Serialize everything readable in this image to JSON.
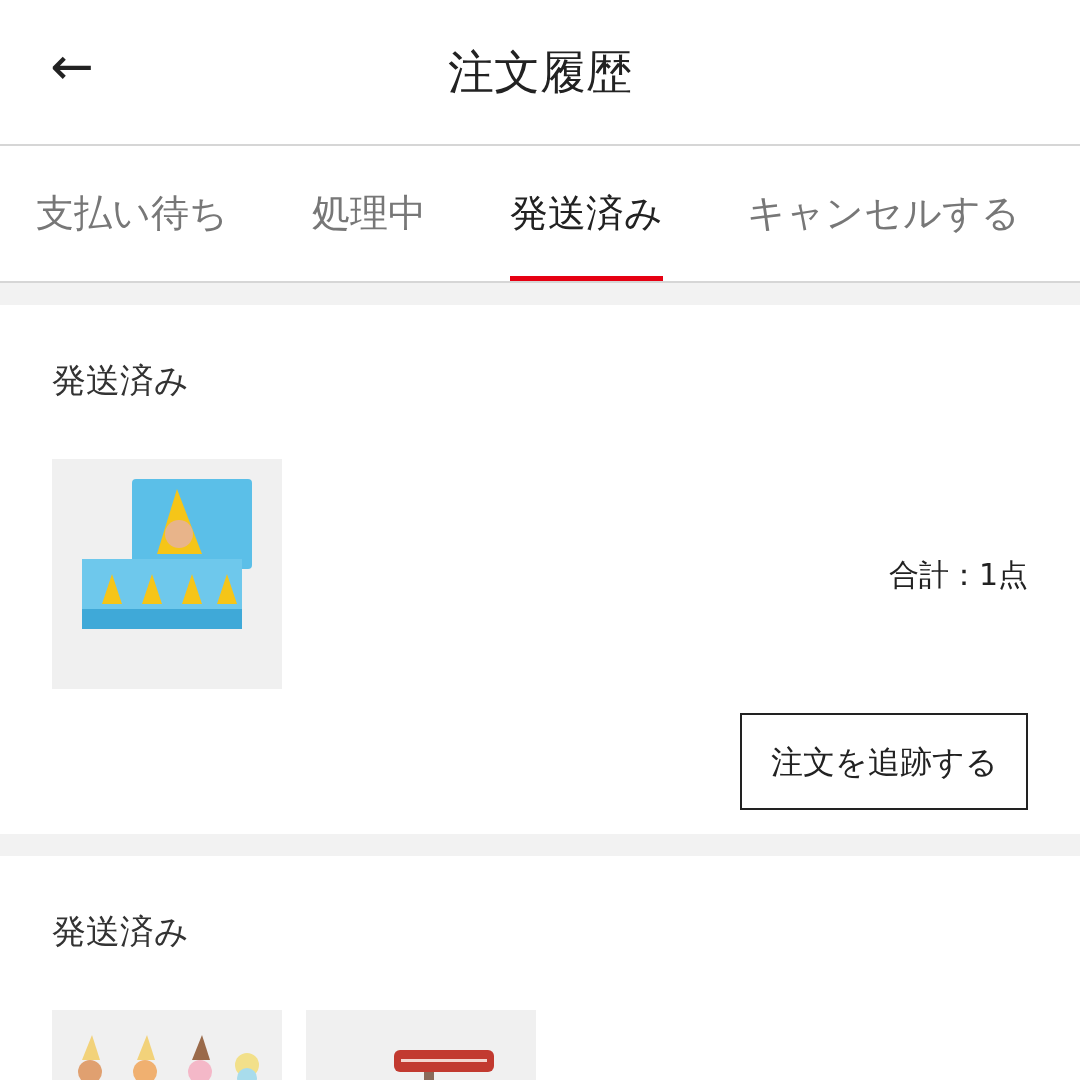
{
  "header": {
    "back_icon": "←",
    "title": "注文履歴"
  },
  "tabs": [
    {
      "label": "支払い待ち",
      "selected": false
    },
    {
      "label": "処理中",
      "selected": false
    },
    {
      "label": "発送済み",
      "selected": true
    },
    {
      "label": "キャンセルする",
      "selected": false
    }
  ],
  "orders": [
    {
      "status": "発送済み",
      "total": "合計：1点",
      "button": "注文を追跡する"
    },
    {
      "status": "発送済み"
    }
  ]
}
